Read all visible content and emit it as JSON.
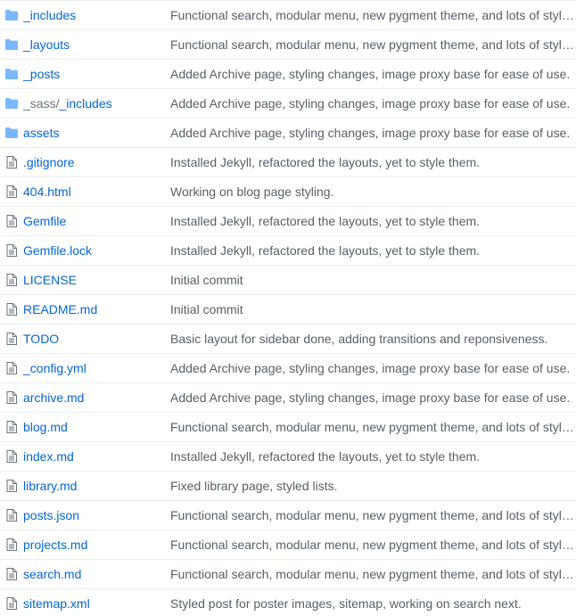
{
  "icons": {
    "folder": "folder-icon",
    "file": "file-icon",
    "folder_color": "#79b8ff",
    "file_color": "#6a737d"
  },
  "files": [
    {
      "type": "folder",
      "name": "_includes",
      "message": "Functional search, modular menu, new pygment theme, and lots of styling."
    },
    {
      "type": "folder",
      "name": "_layouts",
      "message": "Functional search, modular menu, new pygment theme, and lots of styling."
    },
    {
      "type": "folder",
      "name": "_posts",
      "message": "Added Archive page, styling changes, image proxy base for ease of use."
    },
    {
      "type": "folder",
      "prefix": "_sass/",
      "name": "_includes",
      "message": "Added Archive page, styling changes, image proxy base for ease of use."
    },
    {
      "type": "folder",
      "name": "assets",
      "message": "Added Archive page, styling changes, image proxy base for ease of use."
    },
    {
      "type": "file",
      "name": ".gitignore",
      "message": "Installed Jekyll, refactored the layouts, yet to style them."
    },
    {
      "type": "file",
      "name": "404.html",
      "message": "Working on blog page styling."
    },
    {
      "type": "file",
      "name": "Gemfile",
      "message": "Installed Jekyll, refactored the layouts, yet to style them."
    },
    {
      "type": "file",
      "name": "Gemfile.lock",
      "message": "Installed Jekyll, refactored the layouts, yet to style them."
    },
    {
      "type": "file",
      "name": "LICENSE",
      "message": "Initial commit"
    },
    {
      "type": "file",
      "name": "README.md",
      "message": "Initial commit"
    },
    {
      "type": "file",
      "name": "TODO",
      "message": "Basic layout for sidebar done, adding transitions and reponsiveness."
    },
    {
      "type": "file",
      "name": "_config.yml",
      "message": "Added Archive page, styling changes, image proxy base for ease of use."
    },
    {
      "type": "file",
      "name": "archive.md",
      "message": "Added Archive page, styling changes, image proxy base for ease of use."
    },
    {
      "type": "file",
      "name": "blog.md",
      "message": "Functional search, modular menu, new pygment theme, and lots of styling."
    },
    {
      "type": "file",
      "name": "index.md",
      "message": "Installed Jekyll, refactored the layouts, yet to style them."
    },
    {
      "type": "file",
      "name": "library.md",
      "message": "Fixed library page, styled lists."
    },
    {
      "type": "file",
      "name": "posts.json",
      "message": "Functional search, modular menu, new pygment theme, and lots of styling."
    },
    {
      "type": "file",
      "name": "projects.md",
      "message": "Functional search, modular menu, new pygment theme, and lots of styling."
    },
    {
      "type": "file",
      "name": "search.md",
      "message": "Functional search, modular menu, new pygment theme, and lots of styling."
    },
    {
      "type": "file",
      "name": "sitemap.xml",
      "message": "Styled post for poster images, sitemap, working on search next."
    }
  ]
}
